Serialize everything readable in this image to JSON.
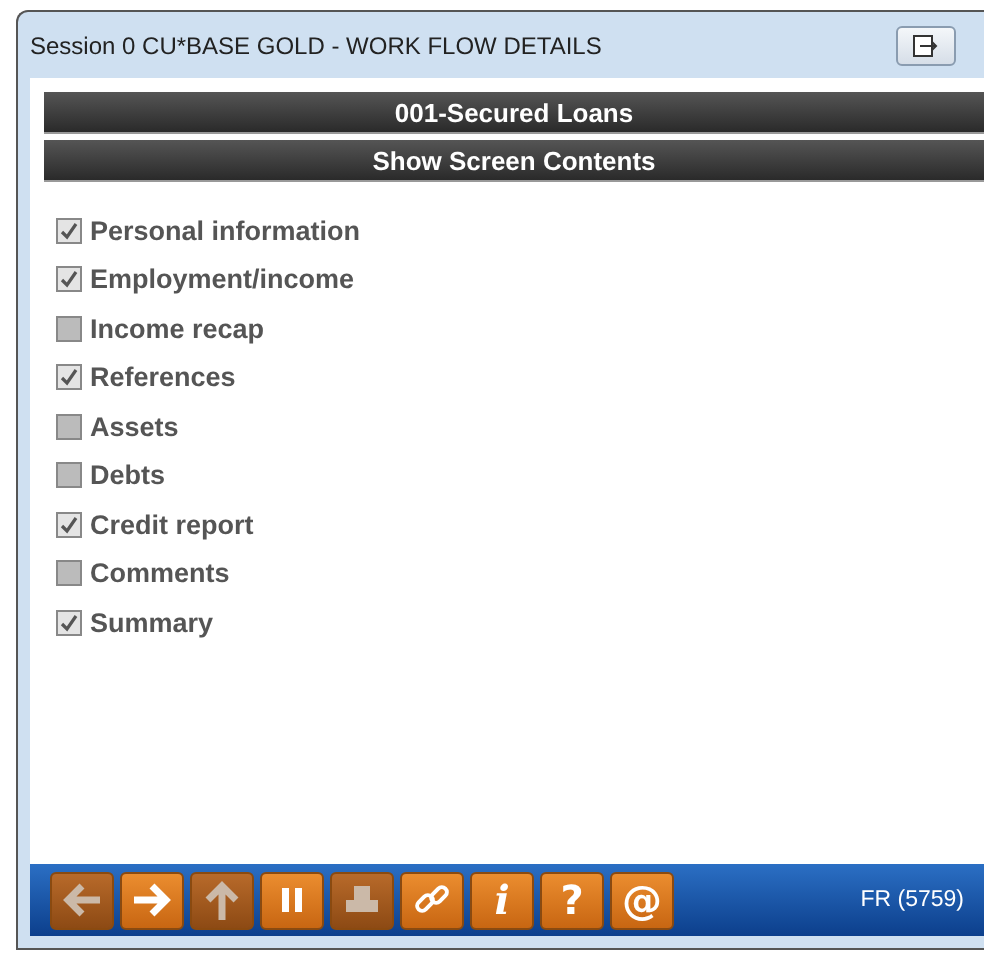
{
  "window": {
    "title": "Session 0 CU*BASE GOLD - WORK FLOW DETAILS"
  },
  "header_bars": [
    "001-Secured Loans",
    "Show Screen Contents"
  ],
  "options": [
    {
      "label": "Personal information",
      "checked": true
    },
    {
      "label": "Employment/income",
      "checked": true
    },
    {
      "label": "Income recap",
      "checked": false
    },
    {
      "label": "References",
      "checked": true
    },
    {
      "label": "Assets",
      "checked": false
    },
    {
      "label": "Debts",
      "checked": false
    },
    {
      "label": "Credit report",
      "checked": true
    },
    {
      "label": "Comments",
      "checked": false
    },
    {
      "label": "Summary",
      "checked": true
    }
  ],
  "toolbar": [
    {
      "kind": "back",
      "disabled": true
    },
    {
      "kind": "forward",
      "disabled": false
    },
    {
      "kind": "up",
      "disabled": true
    },
    {
      "kind": "pause",
      "disabled": false
    },
    {
      "kind": "print",
      "disabled": true
    },
    {
      "kind": "link",
      "disabled": false
    },
    {
      "kind": "glyph",
      "label": "i",
      "italic": true,
      "disabled": false
    },
    {
      "kind": "glyph",
      "label": "?",
      "italic": false,
      "disabled": false
    },
    {
      "kind": "glyph",
      "label": "@",
      "italic": false,
      "disabled": false
    }
  ],
  "status": "FR (5759)"
}
